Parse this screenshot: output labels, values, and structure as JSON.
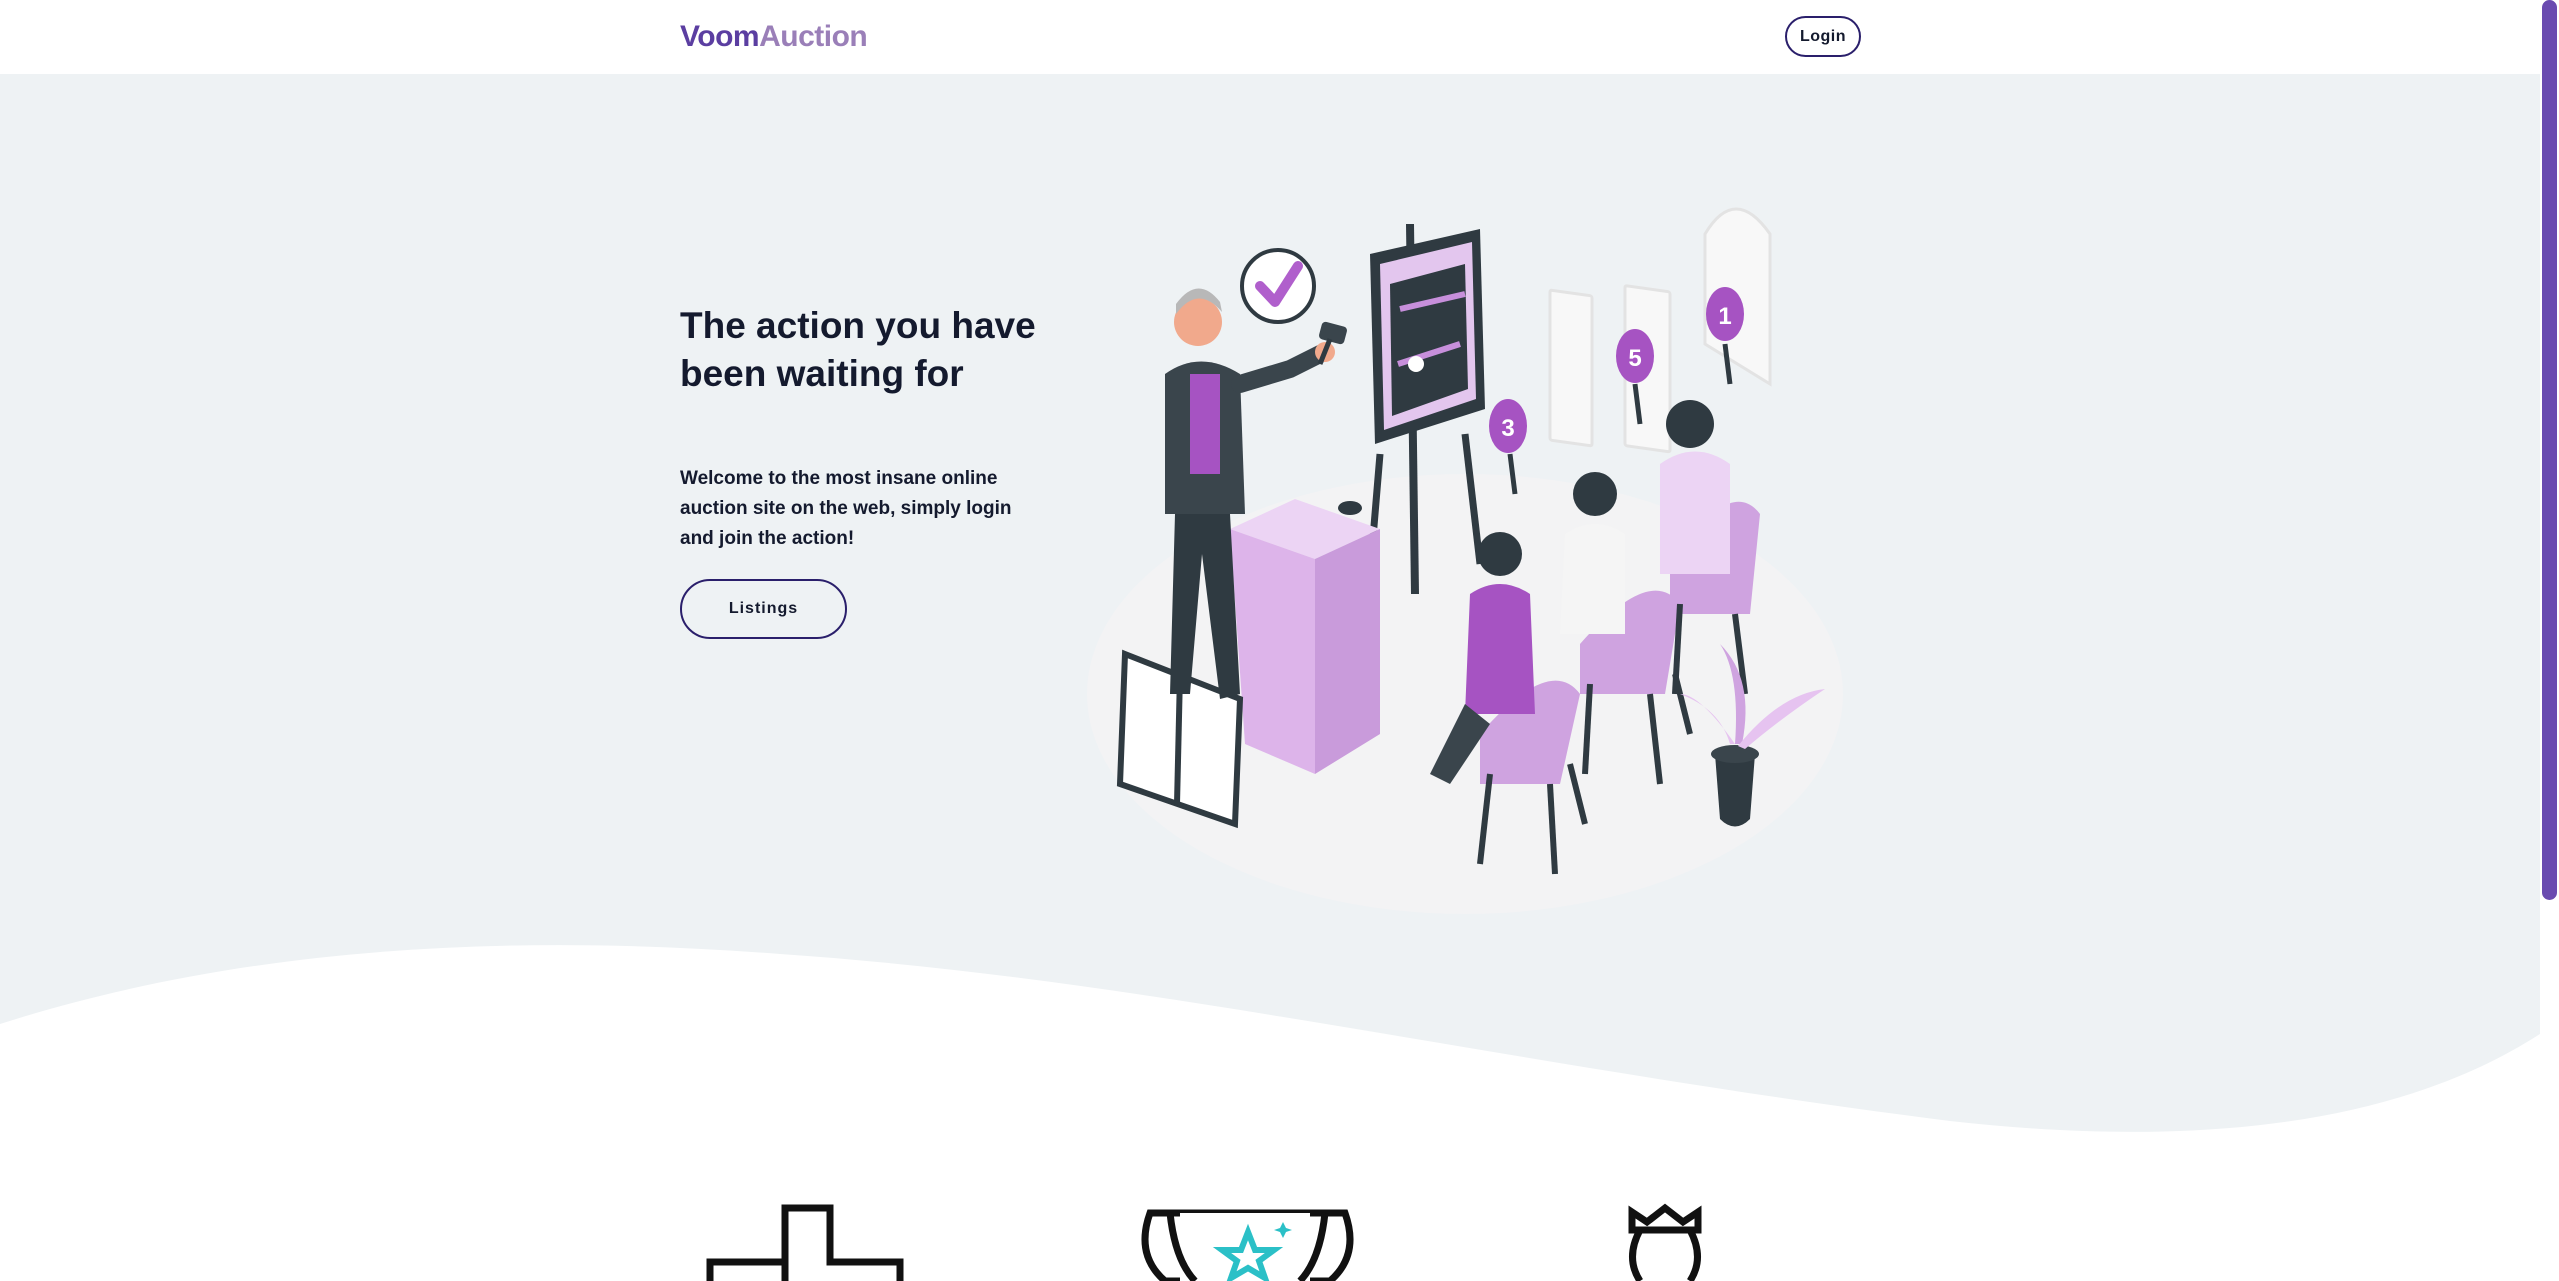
{
  "navbar": {
    "brand_part1": "Voom",
    "brand_part2": "Auction",
    "login_label": "Login"
  },
  "hero": {
    "headline": "The action you have been waiting for",
    "subtext": "Welcome to the most insane online auction site on the web, simply login and join the action!",
    "listings_label": "Listings"
  },
  "illustration": {
    "paddle_numbers": [
      "1",
      "5",
      "3"
    ]
  },
  "features": {
    "icons": [
      "plus-icon",
      "trophy-icon",
      "chess-piece-icon"
    ]
  },
  "colors": {
    "brand_dark": "#5b3ea1",
    "brand_light": "#9a7fb8",
    "button_border": "#2a1f6b",
    "hero_bg": "#eef2f4",
    "accent_purple": "#b05fcc",
    "scrollbar": "#6a4bb0"
  }
}
